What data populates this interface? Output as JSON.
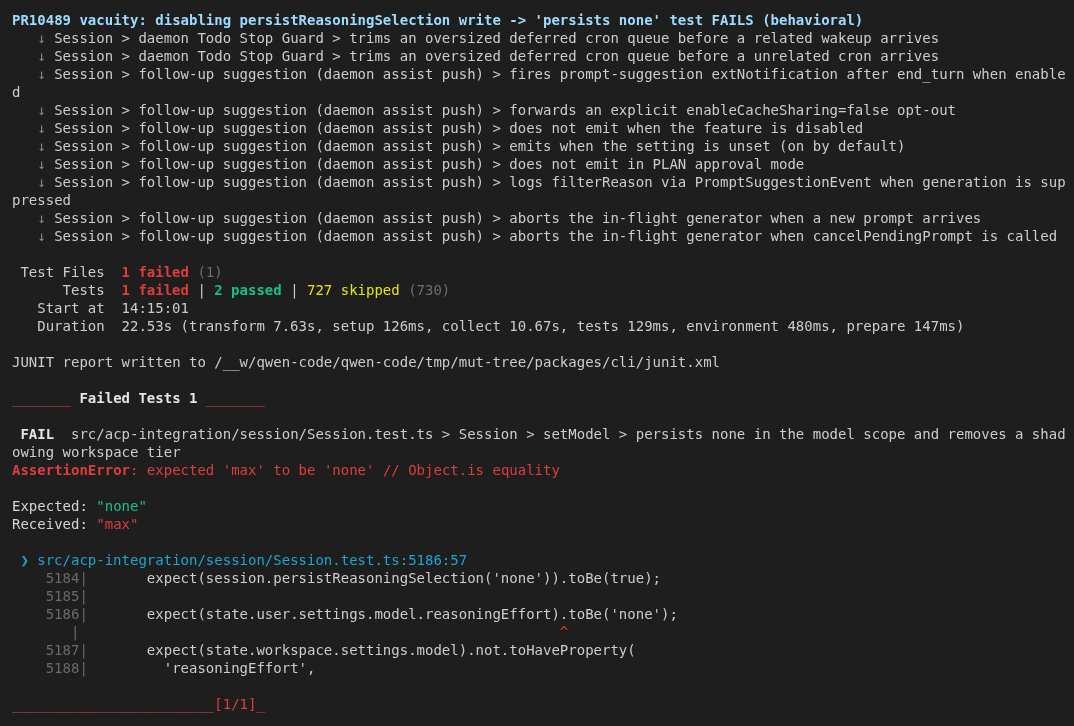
{
  "terminal": {
    "heading": "PR10489 vacuity: disabling persistReasoningSelection write -> 'persists none' test FAILS (behavioral)",
    "test_results": [
      {
        "marker": "↓",
        "name": "Session > daemon Todo Stop Guard > trims an oversized deferred cron queue before a related wakeup arrives"
      },
      {
        "marker": "↓",
        "name": "Session > daemon Todo Stop Guard > trims an oversized deferred cron queue before a unrelated cron arrives"
      },
      {
        "marker": "↓",
        "name": "Session > follow-up suggestion (daemon assist push) > fires prompt-suggestion extNotification after end_turn when enabled"
      },
      {
        "marker": "↓",
        "name": "Session > follow-up suggestion (daemon assist push) > forwards an explicit enableCacheSharing=false opt-out"
      },
      {
        "marker": "↓",
        "name": "Session > follow-up suggestion (daemon assist push) > does not emit when the feature is disabled"
      },
      {
        "marker": "↓",
        "name": "Session > follow-up suggestion (daemon assist push) > emits when the setting is unset (on by default)"
      },
      {
        "marker": "↓",
        "name": "Session > follow-up suggestion (daemon assist push) > does not emit in PLAN approval mode"
      },
      {
        "marker": "↓",
        "name": "Session > follow-up suggestion (daemon assist push) > logs filterReason via PromptSuggestionEvent when generation is suppressed"
      },
      {
        "marker": "↓",
        "name": "Session > follow-up suggestion (daemon assist push) > aborts the in-flight generator when a new prompt arrives"
      },
      {
        "marker": "↓",
        "name": "Session > follow-up suggestion (daemon assist push) > aborts the in-flight generator when cancelPendingPrompt is called"
      }
    ],
    "summary": [
      {
        "label": "Test Files",
        "parts": [
          {
            "kind": "failed",
            "text": "1 failed"
          },
          {
            "kind": "total",
            "text": "(1)"
          }
        ]
      },
      {
        "label": "Tests",
        "parts": [
          {
            "kind": "failed",
            "text": "1 failed"
          },
          {
            "kind": "separator",
            "text": "|"
          },
          {
            "kind": "passed",
            "text": "2 passed"
          },
          {
            "kind": "separator",
            "text": "|"
          },
          {
            "kind": "skipped",
            "text": "727 skipped"
          },
          {
            "kind": "total",
            "text": "(730)"
          }
        ]
      },
      {
        "label": "Start at",
        "parts": [
          {
            "kind": "plain",
            "text": "14:15:01"
          }
        ]
      },
      {
        "label": "Duration",
        "parts": [
          {
            "kind": "plain",
            "text": "22.53s (transform 7.63s, setup 126ms, collect 10.67s, tests 129ms, environment 480ms, prepare 147ms)"
          }
        ]
      }
    ],
    "junit_message": "JUNIT report written to /__w/qwen-code/qwen-code/tmp/mut-tree/packages/cli/junit.xml",
    "failed_heading": "_______ **Failed Tests 1** _______",
    "failure": {
      "badge": "FAIL",
      "test_path": "src/acp-integration/session/Session.test.ts > Session > setModel > persists none in the model scope and removes a shadowing workspace tier",
      "error": "**AssertionError**: expected 'max' to be 'none' // Object.is equality",
      "expected_label": "Expected:",
      "expected_value": "\"none\"",
      "received_label": "Received:",
      "received_value": "\"max\"",
      "location_marker": "❯",
      "location": "src/acp-integration/session/Session.test.ts:5186:57",
      "code_frame": [
        {
          "kind": "source",
          "gutter": "5184|",
          "code": "      expect(session.persistReasoningSelection('none')).toBe(true);"
        },
        {
          "kind": "source",
          "gutter": "5185|"
        },
        {
          "kind": "source",
          "gutter": "5186|",
          "code": "      expect(state.user.settings.model.reasoningEffort).toBe('none');"
        },
        {
          "kind": "caret",
          "gutter": "|",
          "code": "                                                       ^"
        },
        {
          "kind": "source",
          "gutter": "5187|",
          "code": "      expect(state.workspace.settings.model).not.toHaveProperty("
        },
        {
          "kind": "source",
          "gutter": "5188|",
          "code": "        'reasoningEffort',"
        }
      ]
    },
    "footer": "________________________[1/1]_"
  }
}
